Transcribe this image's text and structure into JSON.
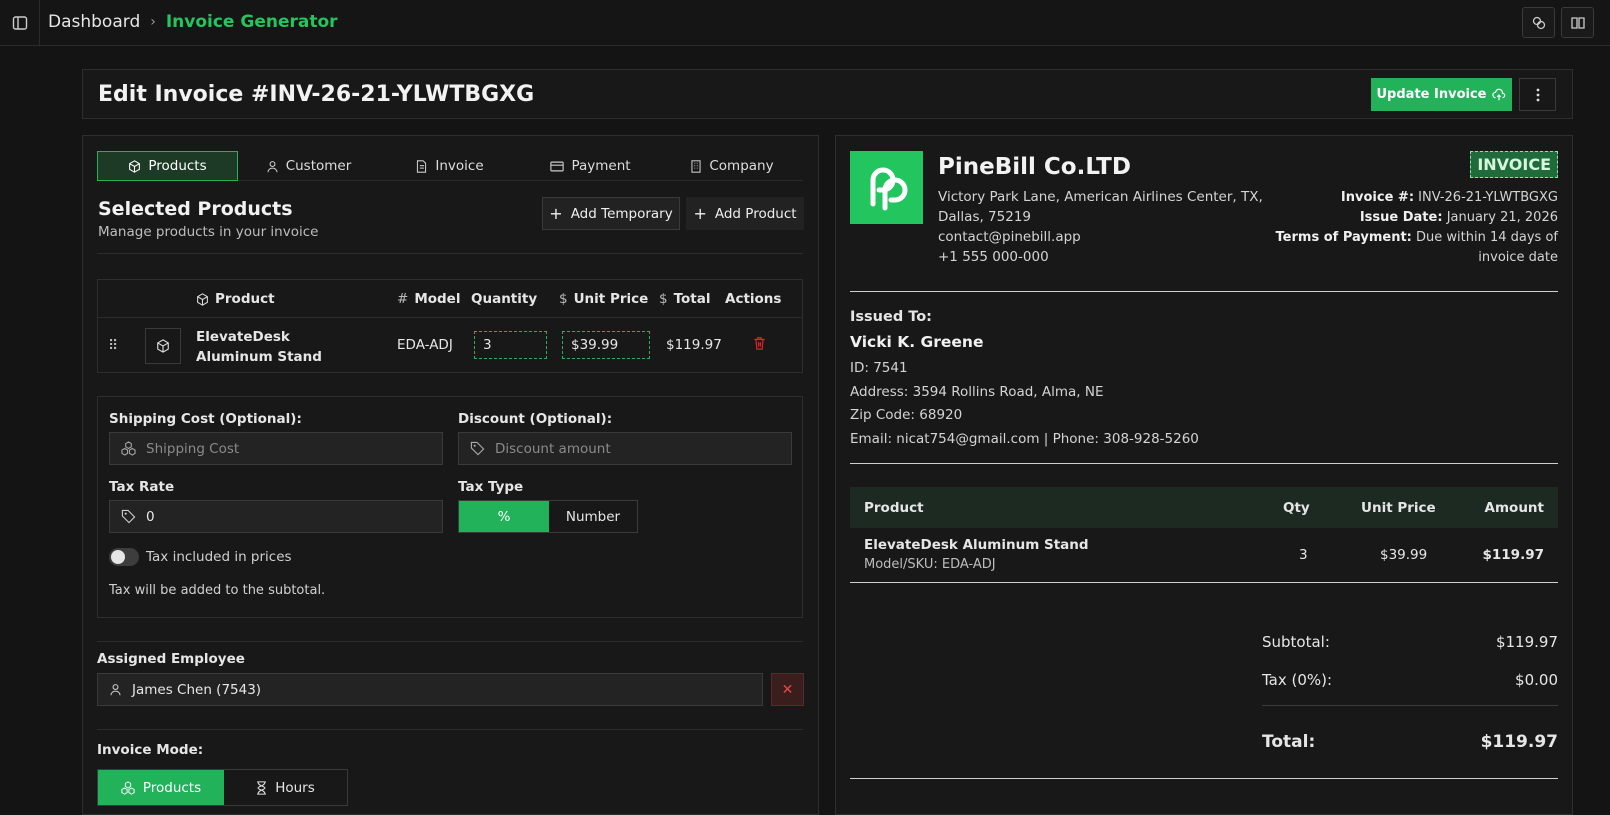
{
  "breadcrumb": {
    "root": "Dashboard",
    "current": "Invoice Generator"
  },
  "header": {
    "title": "Edit Invoice #INV-26-21-YLWTBGXG",
    "update_label": "Update Invoice"
  },
  "tabs": [
    {
      "label": "Products"
    },
    {
      "label": "Customer"
    },
    {
      "label": "Invoice"
    },
    {
      "label": "Payment"
    },
    {
      "label": "Company"
    }
  ],
  "products_section": {
    "title": "Selected Products",
    "subtitle": "Manage products in your invoice",
    "add_temporary": "Add Temporary",
    "add_product": "Add Product"
  },
  "product_table": {
    "headers": {
      "product": "Product",
      "model": "Model",
      "quantity": "Quantity",
      "unit_price": "Unit Price",
      "total": "Total",
      "actions": "Actions"
    },
    "rows": [
      {
        "name": "ElevateDesk Aluminum Stand",
        "model": "EDA-ADJ",
        "quantity": "3",
        "unit_price": "$39.99",
        "total": "$119.97"
      }
    ]
  },
  "settings": {
    "shipping_label": "Shipping Cost (Optional):",
    "shipping_placeholder": "Shipping Cost",
    "discount_label": "Discount (Optional):",
    "discount_placeholder": "Discount amount",
    "tax_rate_label": "Tax Rate",
    "tax_rate_value": "0",
    "tax_type_label": "Tax Type",
    "tax_type_percent": "%",
    "tax_type_number": "Number",
    "tax_included_label": "Tax included in prices",
    "tax_note": "Tax will be added to the subtotal."
  },
  "employee": {
    "label": "Assigned Employee",
    "value": "James Chen (7543)"
  },
  "mode": {
    "label": "Invoice Mode:",
    "products": "Products",
    "hours": "Hours"
  },
  "preview": {
    "company": "PineBill Co.LTD",
    "address1": "Victory Park Lane, American Airlines Center, TX,",
    "address2": "Dallas, 75219",
    "email": "contact@pinebill.app",
    "phone": "+1 555 000-000",
    "badge": "INVOICE",
    "invoice_no_label": "Invoice #:",
    "invoice_no": "INV-26-21-YLWTBGXG",
    "issue_date_label": "Issue Date:",
    "issue_date": "January 21, 2026",
    "terms_label": "Terms of Payment:",
    "terms_1": "Due within 14 days of",
    "terms_2": "invoice date",
    "issued_to_label": "Issued To:",
    "customer_name": "Vicki K. Greene",
    "customer_id": "ID: 7541",
    "customer_address": "Address: 3594 Rollins Road, Alma, NE",
    "customer_zip": "Zip Code: 68920",
    "customer_contact": "Email: nicat754@gmail.com | Phone: 308-928-5260",
    "table_headers": {
      "product": "Product",
      "qty": "Qty",
      "unit_price": "Unit Price",
      "amount": "Amount"
    },
    "rows": [
      {
        "name": "ElevateDesk Aluminum Stand",
        "sku": "Model/SKU: EDA-ADJ",
        "qty": "3",
        "unit_price": "$39.99",
        "amount": "$119.97"
      }
    ],
    "subtotal_label": "Subtotal:",
    "subtotal": "$119.97",
    "tax_label": "Tax (0%):",
    "tax": "$0.00",
    "total_label": "Total:",
    "total": "$119.97"
  },
  "colors": {
    "accent": "#22b35a",
    "danger": "#dc2626",
    "background": "#141414"
  }
}
